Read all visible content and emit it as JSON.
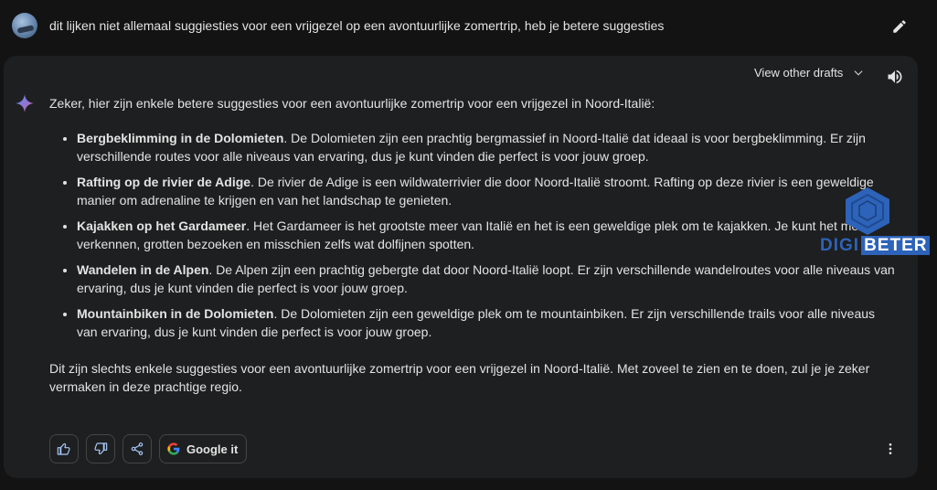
{
  "prompt": {
    "text": "dit lijken niet allemaal suggiesties voor een vrijgezel op een avontuurlijke zomertrip, heb je betere suggesties"
  },
  "response": {
    "view_drafts_label": "View other drafts",
    "intro": "Zeker, hier zijn enkele betere suggesties voor een avontuurlijke zomertrip voor een vrijgezel in Noord-Italië:",
    "items": [
      {
        "title": "Bergbeklimming in de Dolomieten",
        "text": ". De Dolomieten zijn een prachtig bergmassief in Noord-Italië dat ideaal is voor bergbeklimming. Er zijn verschillende routes voor alle niveaus van ervaring, dus je kunt vinden die perfect is voor jouw groep."
      },
      {
        "title": "Rafting op de rivier de Adige",
        "text": ". De rivier de Adige is een wildwaterrivier die door Noord-Italië stroomt. Rafting op deze rivier is een geweldige manier om adrenaline te krijgen en van het landschap te genieten."
      },
      {
        "title": "Kajakken op het Gardameer",
        "text": ". Het Gardameer is het grootste meer van Italië en het is een geweldige plek om te kajakken. Je kunt het meer verkennen, grotten bezoeken en misschien zelfs wat dolfijnen spotten."
      },
      {
        "title": "Wandelen in de Alpen",
        "text": ". De Alpen zijn een prachtig gebergte dat door Noord-Italië loopt. Er zijn verschillende wandelroutes voor alle niveaus van ervaring, dus je kunt vinden die perfect is voor jouw groep."
      },
      {
        "title": "Mountainbiken in de Dolomieten",
        "text": ". De Dolomieten zijn een geweldige plek om te mountainbiken. Er zijn verschillende trails voor alle niveaus van ervaring, dus je kunt vinden die perfect is voor jouw groep."
      }
    ],
    "outro": "Dit zijn slechts enkele suggesties voor een avontuurlijke zomertrip voor een vrijgezel in Noord-Italië. Met zoveel te zien en te doen, zul je je zeker vermaken in deze prachtige regio."
  },
  "actions": {
    "google_it_label": "Google it"
  },
  "watermark": {
    "part1": "DIGI",
    "part2": "BETER"
  },
  "icons": {
    "edit": "pencil-icon",
    "drafts": "chevron-down-icon",
    "speaker": "speaker-icon",
    "spark": "gemini-spark-icon",
    "thumbs_up": "thumbs-up-icon",
    "thumbs_down": "thumbs-down-icon",
    "share": "share-icon",
    "google": "google-g-icon",
    "more": "more-vert-icon"
  },
  "colors": {
    "background": "#131314",
    "card": "#1e1f20",
    "text": "#e3e3e3",
    "watermark_blue": "#2d63b8"
  }
}
